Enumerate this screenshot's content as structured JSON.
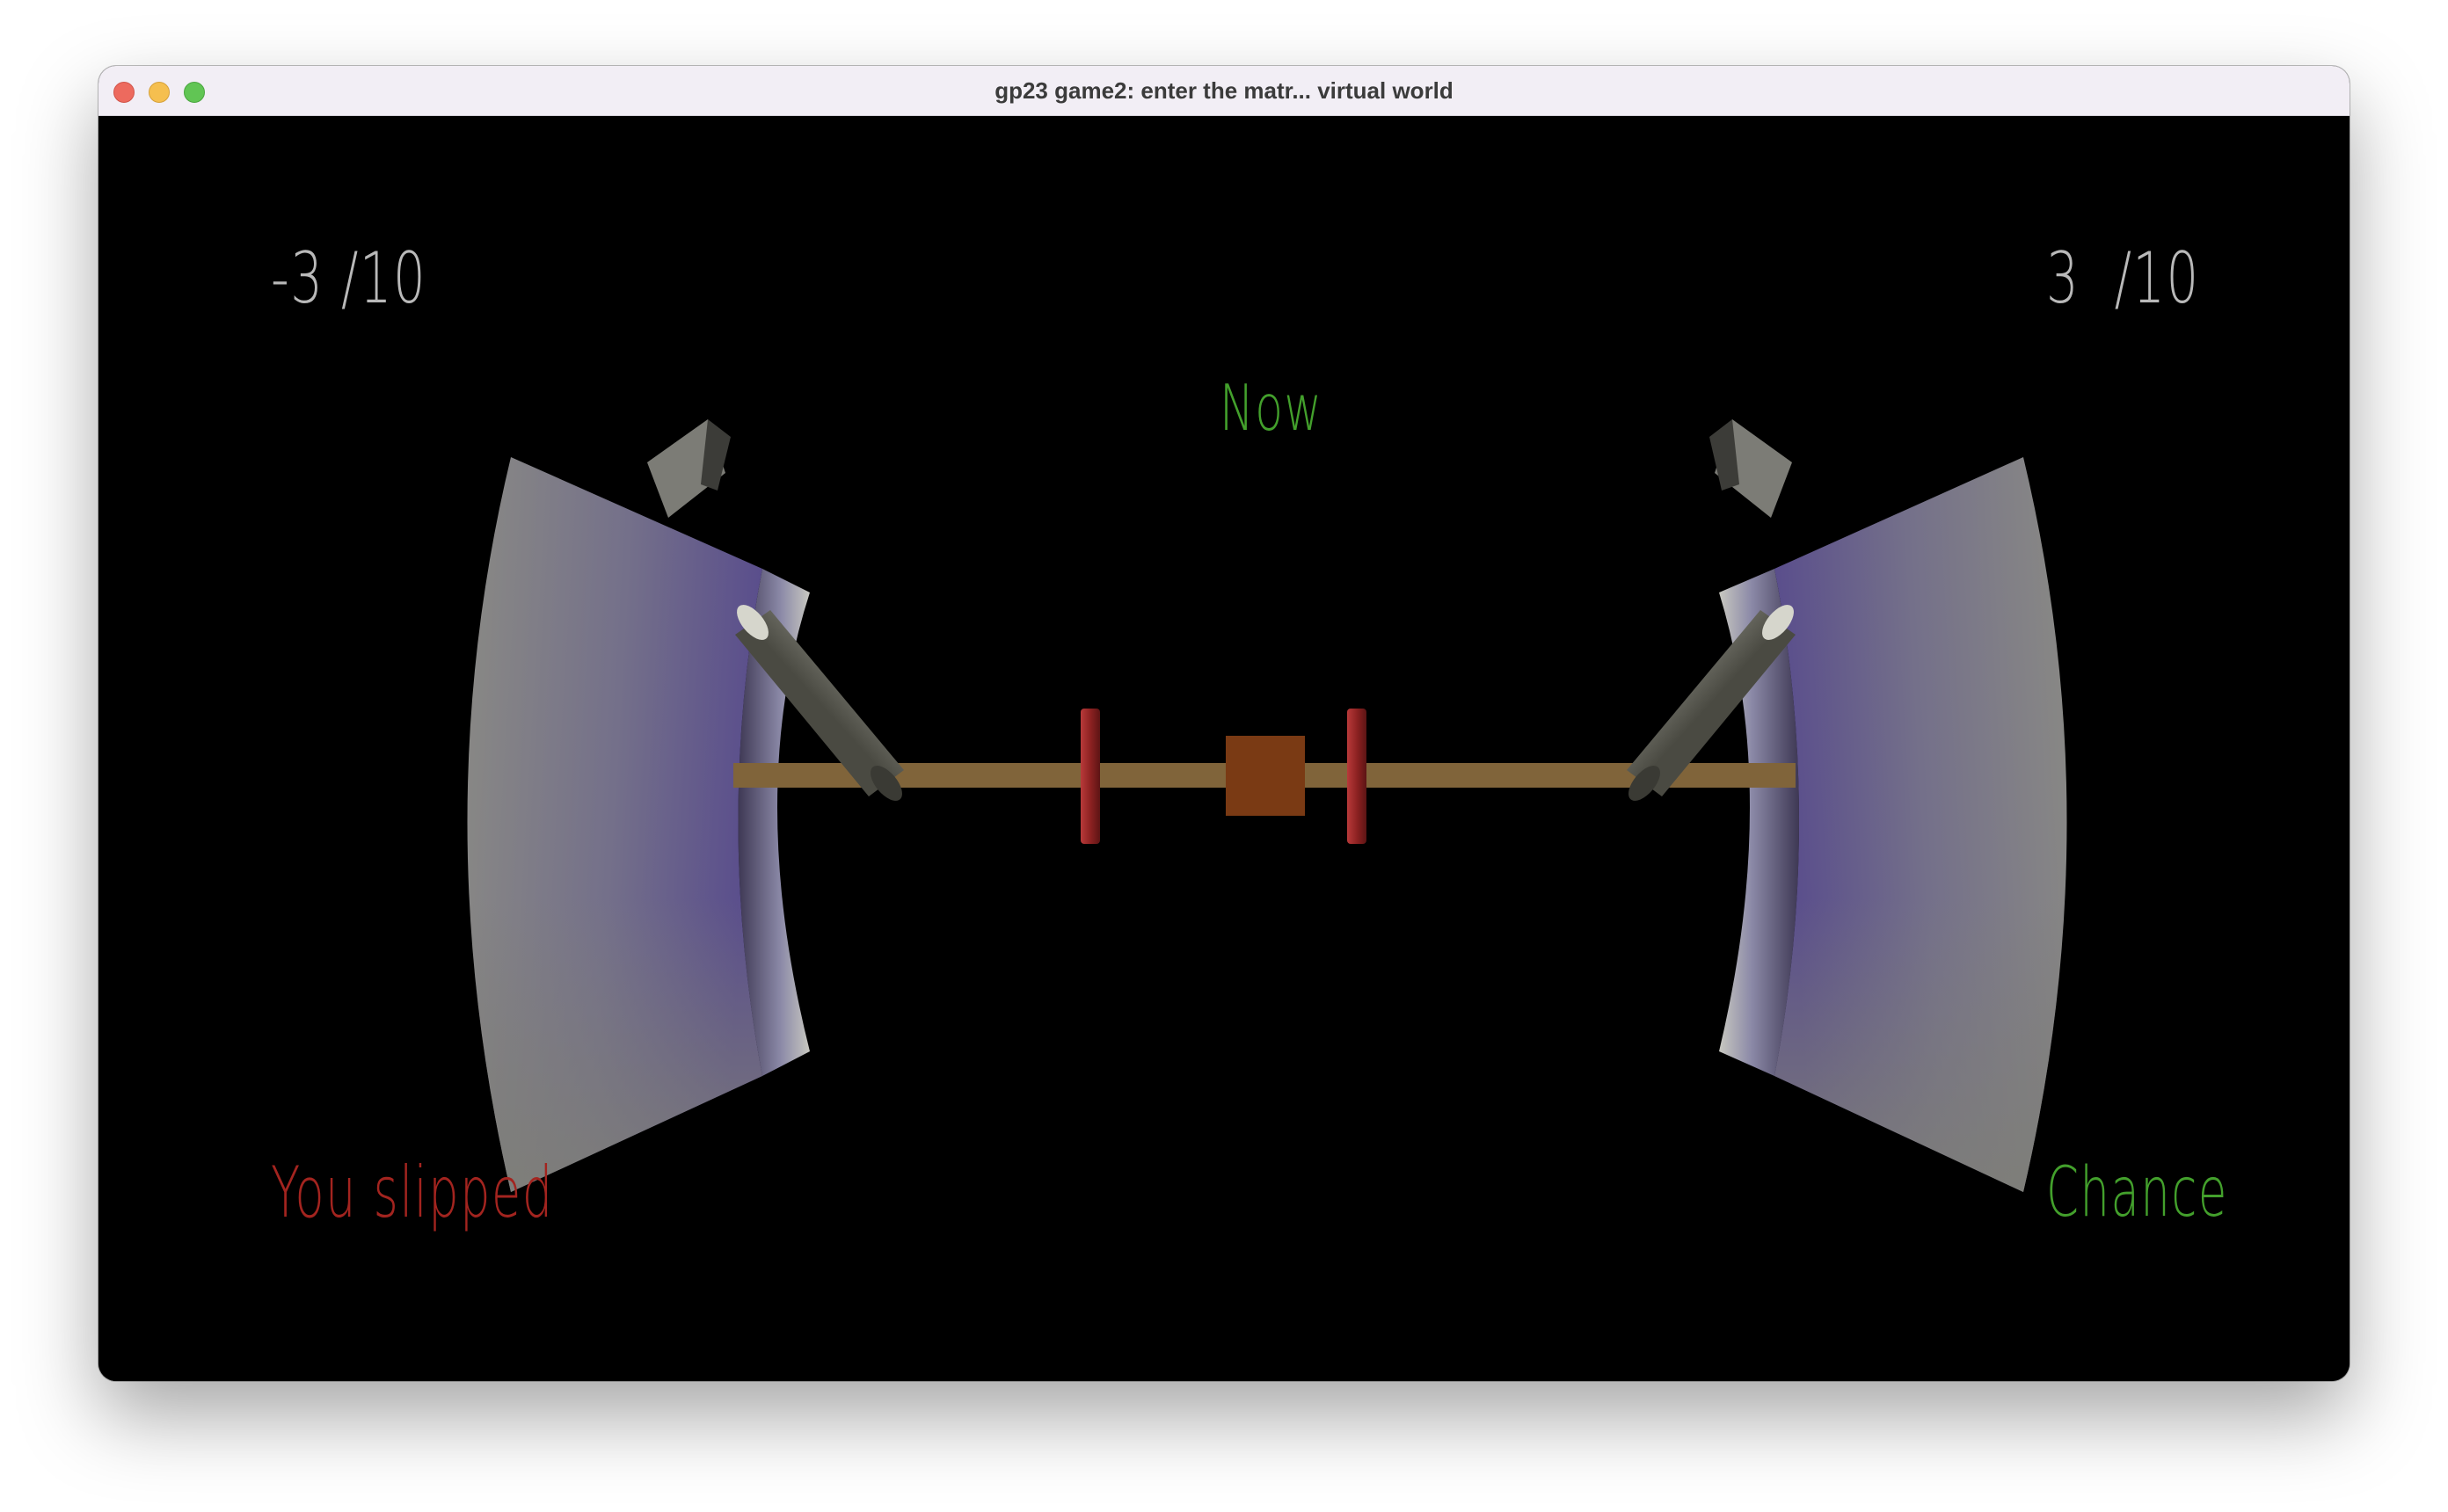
{
  "window": {
    "title": "gp23 game2: enter the matr... virtual world"
  },
  "hud": {
    "left_score": "-3 /10",
    "right_score": "3  /10",
    "center_status": "Now",
    "left_message": "You slipped",
    "right_message": "Chance"
  },
  "colors": {
    "background": "#000000",
    "score_text": "#b9b9b9",
    "success_text": "#43a02c",
    "fail_text": "#a3241f",
    "beam": "#80643a",
    "center_block": "#7a3a14",
    "markers": "#8e2222",
    "shield_gray": "#7e7e78",
    "shield_tint": "#6c5a9c"
  },
  "scene": {
    "objects": [
      "left-shield",
      "right-shield",
      "left-cylinder",
      "right-cylinder",
      "beam",
      "center-block",
      "left-marker",
      "right-marker"
    ]
  }
}
